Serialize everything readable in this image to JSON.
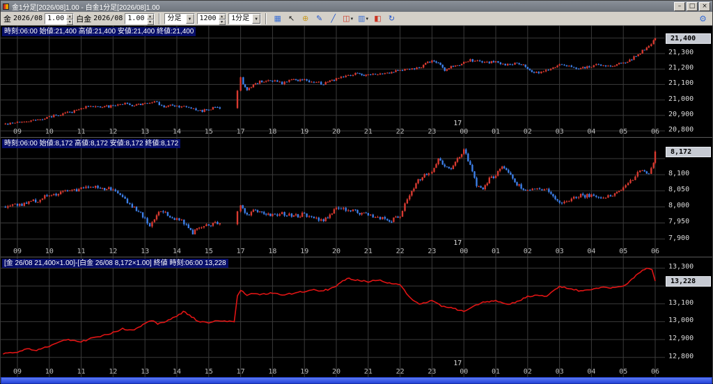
{
  "window": {
    "title": "金1分足[2026/08]1.00 - 白金1分足[2026/08]1.00",
    "buttons": [
      {
        "name": "minimize-button",
        "glyph": "–"
      },
      {
        "name": "maximize-button",
        "glyph": "□"
      },
      {
        "name": "close-button",
        "glyph": "×"
      }
    ]
  },
  "toolbar": {
    "gold_label": "金",
    "gold_month": "2026/08",
    "gold_ratio": "1.00",
    "platinum_label": "白金",
    "platinum_month": "2026/08",
    "platinum_ratio": "1.00",
    "period_dropdown": "分足",
    "bar_count": "1200",
    "interval_dropdown": "1分足",
    "settings_glyph": "⚙",
    "icons": [
      {
        "name": "layout-grid-icon",
        "glyph": "▦",
        "color": "#3b6fd4"
      },
      {
        "name": "cursor-icon",
        "glyph": "↖",
        "color": "#222222"
      },
      {
        "name": "pan-hand-icon",
        "glyph": "⊕",
        "color": "#c89820"
      },
      {
        "name": "pencil-icon",
        "glyph": "✎",
        "color": "#2255cc"
      },
      {
        "name": "trendline-icon",
        "glyph": "╱",
        "color": "#2255cc"
      },
      {
        "name": "chart-type-icon",
        "glyph": "◫",
        "color": "#cc3322",
        "dropdown": true
      },
      {
        "name": "indicator-icon",
        "glyph": "▥",
        "color": "#3b6fd4",
        "dropdown": true
      },
      {
        "name": "compare-icon",
        "glyph": "◧",
        "color": "#cc3322"
      },
      {
        "name": "refresh-icon",
        "glyph": "↻",
        "color": "#2255cc"
      }
    ]
  },
  "chart_data": [
    {
      "type": "candlestick",
      "title": "金 1分足 2026/08",
      "info": "時刻:06:00 始値:21,400 高値:21,400 安値:21,400 終値:21,400",
      "x_labels": [
        "09",
        "10",
        "11",
        "12",
        "13",
        "14",
        "15",
        "17",
        "18",
        "19",
        "20",
        "21",
        "22",
        "23",
        "00",
        "01",
        "02",
        "03",
        "04",
        "05",
        "06"
      ],
      "date_label": {
        "text": "17",
        "index": 14
      },
      "y_domain": [
        20760,
        21480
      ],
      "y_ticks": [
        {
          "value": 21400,
          "label": "21,400",
          "highlight": true
        },
        {
          "value": 21300,
          "label": "21,300"
        },
        {
          "value": 21200,
          "label": "21,200"
        },
        {
          "value": 21100,
          "label": "21,100"
        },
        {
          "value": 21000,
          "label": "21,000"
        },
        {
          "value": 20900,
          "label": "20,900"
        },
        {
          "value": 20800,
          "label": "20,800"
        }
      ],
      "grid_values": [
        21400,
        21300,
        21200,
        21100,
        21000,
        20900,
        20800
      ],
      "up_color": "#d83a30",
      "down_color": "#3d7fe8",
      "noise": 12,
      "anchors": [
        [
          -0.45,
          20845
        ],
        [
          0,
          20852
        ],
        [
          0.5,
          20868
        ],
        [
          1,
          20888
        ],
        [
          1.5,
          20915
        ],
        [
          2,
          20948
        ],
        [
          2.3,
          20960
        ],
        [
          2.6,
          20952
        ],
        [
          3,
          20962
        ],
        [
          3.3,
          20975
        ],
        [
          3.6,
          20965
        ],
        [
          4,
          20975
        ],
        [
          4.3,
          20988
        ],
        [
          4.6,
          20958
        ],
        [
          5,
          20966
        ],
        [
          5.3,
          20950
        ],
        [
          5.6,
          20938
        ],
        [
          5.8,
          20928
        ],
        [
          6,
          20936
        ],
        [
          6.2,
          20952
        ],
        [
          6.8,
          20948
        ],
        [
          6.9,
          21055
        ],
        [
          7,
          21148
        ],
        [
          7.08,
          21095
        ],
        [
          7.2,
          21060
        ],
        [
          7.4,
          21098
        ],
        [
          7.6,
          21118
        ],
        [
          8,
          21128
        ],
        [
          8.3,
          21112
        ],
        [
          8.6,
          21128
        ],
        [
          9,
          21132
        ],
        [
          9.3,
          21112
        ],
        [
          9.6,
          21102
        ],
        [
          10,
          21138
        ],
        [
          10.3,
          21158
        ],
        [
          10.6,
          21168
        ],
        [
          11,
          21158
        ],
        [
          11.3,
          21172
        ],
        [
          11.6,
          21178
        ],
        [
          12,
          21192
        ],
        [
          12.3,
          21198
        ],
        [
          12.6,
          21208
        ],
        [
          12.8,
          21228
        ],
        [
          13,
          21258
        ],
        [
          13.2,
          21238
        ],
        [
          13.4,
          21192
        ],
        [
          13.6,
          21208
        ],
        [
          13.8,
          21228
        ],
        [
          14,
          21238
        ],
        [
          14.2,
          21258
        ],
        [
          14.5,
          21248
        ],
        [
          14.8,
          21238
        ],
        [
          15,
          21248
        ],
        [
          15.3,
          21228
        ],
        [
          15.6,
          21238
        ],
        [
          16,
          21208
        ],
        [
          16.2,
          21172
        ],
        [
          16.5,
          21188
        ],
        [
          16.8,
          21208
        ],
        [
          17,
          21228
        ],
        [
          17.3,
          21218
        ],
        [
          17.6,
          21198
        ],
        [
          18,
          21218
        ],
        [
          18.3,
          21228
        ],
        [
          18.6,
          21222
        ],
        [
          19,
          21238
        ],
        [
          19.2,
          21258
        ],
        [
          19.4,
          21288
        ],
        [
          19.6,
          21318
        ],
        [
          19.8,
          21345
        ],
        [
          19.95,
          21380
        ],
        [
          20,
          21400
        ]
      ]
    },
    {
      "type": "candlestick",
      "title": "白金 1分足 2026/08",
      "info": "時刻:06:00 始値:8,172 高値:8,172 安値:8,172 終値:8,172",
      "x_labels": [
        "09",
        "10",
        "11",
        "12",
        "13",
        "14",
        "15",
        "17",
        "18",
        "19",
        "20",
        "21",
        "22",
        "23",
        "00",
        "01",
        "02",
        "03",
        "04",
        "05",
        "06"
      ],
      "date_label": {
        "text": "17",
        "index": 14
      },
      "y_domain": [
        7845,
        8215
      ],
      "y_ticks": [
        {
          "value": 8172,
          "label": "8,172",
          "highlight": true
        },
        {
          "value": 8100,
          "label": "8,100"
        },
        {
          "value": 8050,
          "label": "8,050"
        },
        {
          "value": 8000,
          "label": "8,000"
        },
        {
          "value": 7950,
          "label": "7,950"
        },
        {
          "value": 7900,
          "label": "7,900"
        }
      ],
      "grid_values": [
        8150,
        8100,
        8050,
        8000,
        7950,
        7900
      ],
      "up_color": "#d83a30",
      "down_color": "#3d7fe8",
      "noise": 9,
      "anchors": [
        [
          -0.45,
          7998
        ],
        [
          0,
          8004
        ],
        [
          0.5,
          8018
        ],
        [
          1,
          8034
        ],
        [
          1.5,
          8048
        ],
        [
          2,
          8058
        ],
        [
          2.3,
          8064
        ],
        [
          2.6,
          8058
        ],
        [
          3,
          8054
        ],
        [
          3.3,
          8030
        ],
        [
          3.6,
          8000
        ],
        [
          4,
          7968
        ],
        [
          4.15,
          7938
        ],
        [
          4.3,
          7965
        ],
        [
          4.5,
          7982
        ],
        [
          5,
          7962
        ],
        [
          5.3,
          7944
        ],
        [
          5.5,
          7918
        ],
        [
          5.7,
          7934
        ],
        [
          6,
          7940
        ],
        [
          6.2,
          7950
        ],
        [
          6.8,
          7944
        ],
        [
          6.9,
          7985
        ],
        [
          7,
          8000
        ],
        [
          7.2,
          7974
        ],
        [
          7.4,
          7990
        ],
        [
          7.6,
          7984
        ],
        [
          8,
          7974
        ],
        [
          8.3,
          7980
        ],
        [
          8.6,
          7970
        ],
        [
          9,
          7976
        ],
        [
          9.3,
          7964
        ],
        [
          9.6,
          7958
        ],
        [
          10,
          7994
        ],
        [
          10.3,
          7988
        ],
        [
          10.6,
          7984
        ],
        [
          11,
          7978
        ],
        [
          11.3,
          7968
        ],
        [
          11.6,
          7954
        ],
        [
          12,
          7974
        ],
        [
          12.15,
          8005
        ],
        [
          12.3,
          8040
        ],
        [
          12.5,
          8075
        ],
        [
          12.7,
          8092
        ],
        [
          12.9,
          8102
        ],
        [
          13,
          8112
        ],
        [
          13.2,
          8148
        ],
        [
          13.4,
          8128
        ],
        [
          13.6,
          8118
        ],
        [
          13.8,
          8148
        ],
        [
          14,
          8174
        ],
        [
          14.2,
          8128
        ],
        [
          14.4,
          8068
        ],
        [
          14.6,
          8058
        ],
        [
          14.8,
          8088
        ],
        [
          15,
          8098
        ],
        [
          15.2,
          8124
        ],
        [
          15.4,
          8108
        ],
        [
          15.6,
          8078
        ],
        [
          16,
          8048
        ],
        [
          16.3,
          8058
        ],
        [
          16.6,
          8052
        ],
        [
          17,
          8008
        ],
        [
          17.3,
          8024
        ],
        [
          17.6,
          8034
        ],
        [
          18,
          8038
        ],
        [
          18.3,
          8028
        ],
        [
          18.6,
          8034
        ],
        [
          19,
          8058
        ],
        [
          19.3,
          8088
        ],
        [
          19.6,
          8118
        ],
        [
          19.8,
          8108
        ],
        [
          19.95,
          8140
        ],
        [
          20,
          8172
        ]
      ]
    },
    {
      "type": "line",
      "title": "スプレッド 金-白金",
      "info": "[金 26/08 21,400×1.00]-[白金 26/08 8,172×1.00] 終値 時刻:06:00 13,228",
      "x_labels": [
        "09",
        "10",
        "11",
        "12",
        "13",
        "14",
        "15",
        "17",
        "18",
        "19",
        "20",
        "21",
        "22",
        "23",
        "00",
        "01",
        "02",
        "03",
        "04",
        "05",
        "06"
      ],
      "date_label": {
        "text": "17",
        "index": 14
      },
      "y_domain": [
        12690,
        13360
      ],
      "y_ticks": [
        {
          "value": 13300,
          "label": "13,300"
        },
        {
          "value": 13228,
          "label": "13,228",
          "highlight": true
        },
        {
          "value": 13100,
          "label": "13,100"
        },
        {
          "value": 13000,
          "label": "13,000"
        },
        {
          "value": 12900,
          "label": "12,900"
        },
        {
          "value": 12800,
          "label": "12,800"
        }
      ],
      "grid_values": [
        13300,
        13200,
        13100,
        13000,
        12900,
        12800
      ],
      "line_color": "#e01414",
      "noise": 6,
      "anchors": [
        [
          -0.45,
          12822
        ],
        [
          0,
          12830
        ],
        [
          0.3,
          12848
        ],
        [
          0.6,
          12840
        ],
        [
          1,
          12862
        ],
        [
          1.3,
          12888
        ],
        [
          1.6,
          12898
        ],
        [
          2,
          12888
        ],
        [
          2.3,
          12908
        ],
        [
          2.6,
          12918
        ],
        [
          3,
          12938
        ],
        [
          3.3,
          12958
        ],
        [
          3.6,
          12948
        ],
        [
          4,
          12988
        ],
        [
          4.2,
          13008
        ],
        [
          4.4,
          12988
        ],
        [
          4.6,
          12998
        ],
        [
          5,
          13028
        ],
        [
          5.2,
          13058
        ],
        [
          5.4,
          13038
        ],
        [
          5.6,
          13008
        ],
        [
          5.8,
          12998
        ],
        [
          6,
          12994
        ],
        [
          6.2,
          13004
        ],
        [
          6.8,
          13002
        ],
        [
          6.9,
          13148
        ],
        [
          7,
          13178
        ],
        [
          7.2,
          13148
        ],
        [
          7.4,
          13158
        ],
        [
          7.6,
          13148
        ],
        [
          8,
          13164
        ],
        [
          8.3,
          13148
        ],
        [
          8.6,
          13158
        ],
        [
          9,
          13168
        ],
        [
          9.3,
          13178
        ],
        [
          9.6,
          13172
        ],
        [
          10,
          13198
        ],
        [
          10.2,
          13228
        ],
        [
          10.4,
          13244
        ],
        [
          10.6,
          13234
        ],
        [
          11,
          13224
        ],
        [
          11.3,
          13234
        ],
        [
          11.6,
          13218
        ],
        [
          12,
          13208
        ],
        [
          12.2,
          13158
        ],
        [
          12.4,
          13118
        ],
        [
          12.6,
          13098
        ],
        [
          12.8,
          13108
        ],
        [
          13,
          13118
        ],
        [
          13.3,
          13088
        ],
        [
          13.6,
          13078
        ],
        [
          14,
          13058
        ],
        [
          14.3,
          13088
        ],
        [
          14.6,
          13108
        ],
        [
          15,
          13118
        ],
        [
          15.3,
          13098
        ],
        [
          15.6,
          13108
        ],
        [
          16,
          13138
        ],
        [
          16.3,
          13148
        ],
        [
          16.6,
          13142
        ],
        [
          17,
          13198
        ],
        [
          17.3,
          13184
        ],
        [
          17.6,
          13174
        ],
        [
          18,
          13178
        ],
        [
          18.3,
          13194
        ],
        [
          18.6,
          13188
        ],
        [
          19,
          13198
        ],
        [
          19.2,
          13228
        ],
        [
          19.4,
          13258
        ],
        [
          19.6,
          13288
        ],
        [
          19.8,
          13302
        ],
        [
          19.9,
          13292
        ],
        [
          20,
          13228
        ]
      ]
    }
  ]
}
